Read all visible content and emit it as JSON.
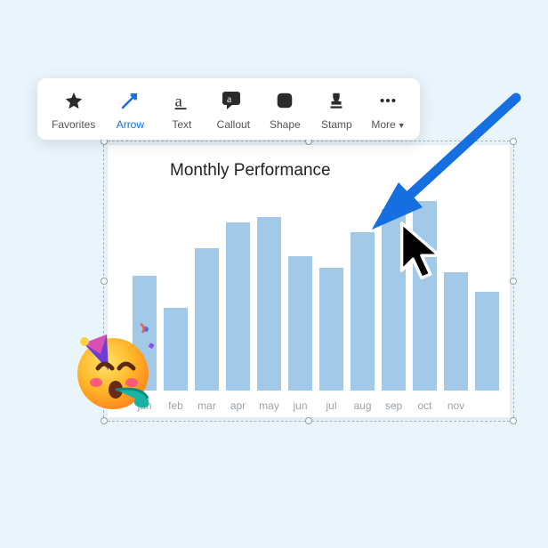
{
  "toolbar": {
    "items": [
      {
        "key": "favorites",
        "label": "Favorites",
        "icon": "star-icon",
        "active": false
      },
      {
        "key": "arrow",
        "label": "Arrow",
        "icon": "arrow-icon",
        "active": true
      },
      {
        "key": "text",
        "label": "Text",
        "icon": "text-icon",
        "active": false
      },
      {
        "key": "callout",
        "label": "Callout",
        "icon": "callout-icon",
        "active": false
      },
      {
        "key": "shape",
        "label": "Shape",
        "icon": "shape-icon",
        "active": false
      },
      {
        "key": "stamp",
        "label": "Stamp",
        "icon": "stamp-icon",
        "active": false
      },
      {
        "key": "more",
        "label": "More",
        "icon": "more-icon",
        "active": false
      }
    ]
  },
  "chart_data": {
    "type": "bar",
    "title": "Monthly Performance",
    "categories": [
      "jan",
      "feb",
      "mar",
      "apr",
      "may",
      "jun",
      "jul",
      "aug",
      "sep",
      "oct",
      "nov"
    ],
    "values": [
      58,
      42,
      72,
      85,
      88,
      68,
      62,
      80,
      92,
      96,
      60,
      50
    ],
    "xlabel": "",
    "ylabel": "",
    "ylim": [
      0,
      100
    ]
  },
  "annotations": {
    "arrow_color": "#166fe0",
    "sticker": "party-face-emoji"
  }
}
